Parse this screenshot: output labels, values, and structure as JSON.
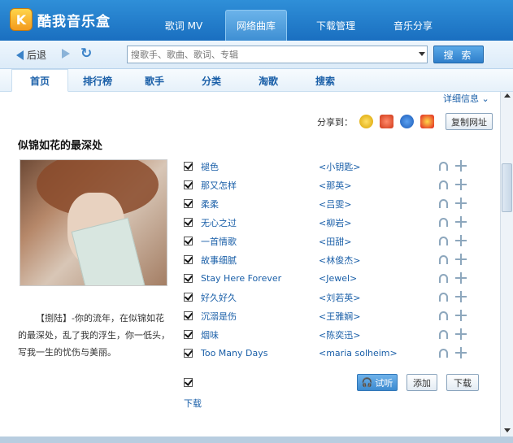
{
  "app": {
    "title": "酷我音乐盒",
    "logo_letter": "K"
  },
  "main_tabs": [
    {
      "label": "歌词 MV"
    },
    {
      "label": "网络曲库"
    },
    {
      "label": "下载管理"
    },
    {
      "label": "音乐分享"
    }
  ],
  "toolbar": {
    "back_label": "后退",
    "search_placeholder": "搜歌手、歌曲、歌词、专辑",
    "search_button": "搜 索"
  },
  "sub_tabs": [
    {
      "label": "首页"
    },
    {
      "label": "排行榜"
    },
    {
      "label": "歌手"
    },
    {
      "label": "分类"
    },
    {
      "label": "淘歌"
    },
    {
      "label": "搜索"
    }
  ],
  "album": {
    "detail_link": "详细信息",
    "share_label": "分享到：",
    "copy_button": "复制网址",
    "title": "似锦如花的最深处",
    "description": "【捌陆】-你的流年，在似锦如花的最深处，乱了我的浮生，你一低头，写我一生的忧伤与美丽。"
  },
  "songs": [
    {
      "name": "褪色",
      "artist": "<小钥匙>"
    },
    {
      "name": "那又怎样",
      "artist": "<那英>"
    },
    {
      "name": "柔柔",
      "artist": "<吕雯>"
    },
    {
      "name": "无心之过",
      "artist": "<柳岩>"
    },
    {
      "name": "一首情歌",
      "artist": "<田甜>"
    },
    {
      "name": "故事细腻",
      "artist": "<林俊杰>"
    },
    {
      "name": "Stay Here Forever",
      "artist": "<Jewel>"
    },
    {
      "name": "好久好久",
      "artist": "<刘若英>"
    },
    {
      "name": "沉溺是伤",
      "artist": "<王雅娴>"
    },
    {
      "name": "烟味",
      "artist": "<陈奕迅>"
    },
    {
      "name": "Too Many Days",
      "artist": "<maria solheim>"
    }
  ],
  "actions": {
    "listen": "试听",
    "add": "添加",
    "download": "下载",
    "download_link": "下载"
  }
}
